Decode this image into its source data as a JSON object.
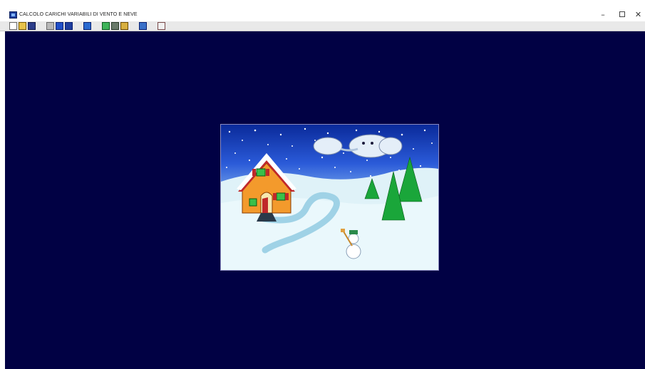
{
  "window": {
    "title": "CALCOLO CARICHI VARIABILI DI VENTO E NEVE",
    "controls": {
      "minimize": "–",
      "close": "✕"
    }
  },
  "toolbar": {
    "buttons": [
      {
        "name": "new-file",
        "icon": "new-file-icon"
      },
      {
        "name": "open-folder",
        "icon": "open-folder-icon"
      },
      {
        "name": "save",
        "icon": "save-icon"
      },
      {
        "name": "tool-1",
        "icon": "tool-icon"
      },
      {
        "name": "tool-2",
        "icon": "tool-icon"
      },
      {
        "name": "tool-3",
        "icon": "tool-icon"
      },
      {
        "name": "tool-4",
        "icon": "tool-icon"
      },
      {
        "name": "tool-5",
        "icon": "tool-icon"
      },
      {
        "name": "tool-6",
        "icon": "tool-icon"
      },
      {
        "name": "tool-7",
        "icon": "tool-icon"
      },
      {
        "name": "tool-8",
        "icon": "tool-icon"
      },
      {
        "name": "tool-9",
        "icon": "tool-icon"
      }
    ]
  },
  "main": {
    "background_color": "#010144",
    "splash_image": "winter-scene-illustration"
  }
}
